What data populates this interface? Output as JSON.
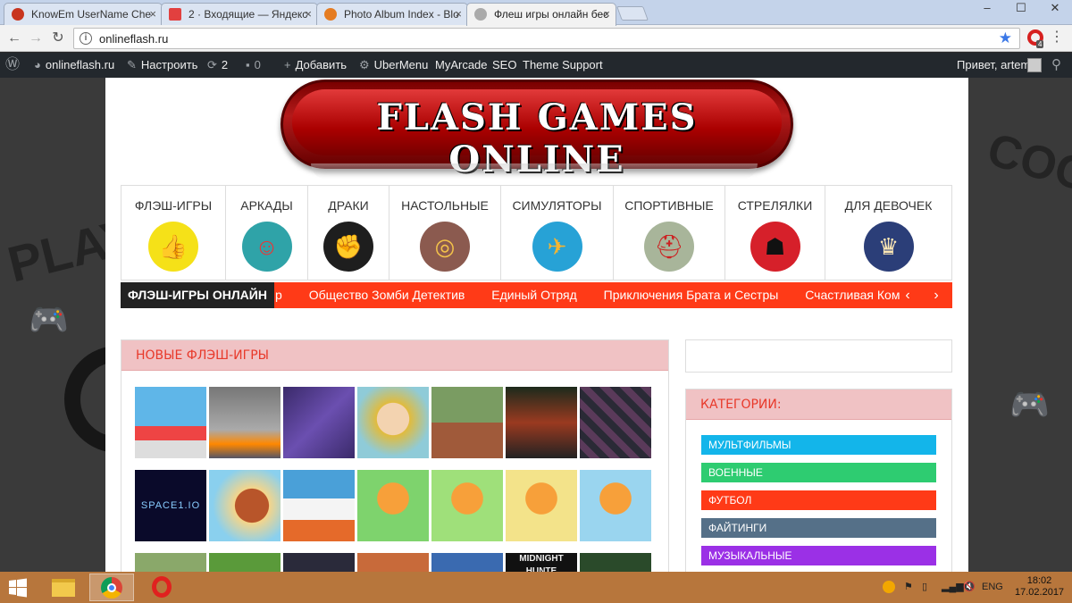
{
  "browser": {
    "tabs": [
      {
        "title": "KnowEm UserName Che",
        "favicon_color": "#c8351f"
      },
      {
        "title": "2 · Входящие — Яндекс",
        "favicon_color": "#e2403f"
      },
      {
        "title": "Photo Album Index - Blo",
        "favicon_color": "#e57c22"
      },
      {
        "title": "Флеш игры онлайн бес",
        "favicon_color": "#888888"
      }
    ],
    "url": "onlineflash.ru",
    "extension_badge": "4"
  },
  "adminbar": {
    "site": "onlineflash.ru",
    "customize": "Настроить",
    "updates": "2",
    "comments": "0",
    "add": "Добавить",
    "ubermenu": "UberMenu",
    "myarcade": "MyArcade",
    "seo": "SEO",
    "theme_support": "Theme Support",
    "greeting": "Привет, artem"
  },
  "site": {
    "logo_text": "FLASH GAMES ONLINE",
    "categories": [
      {
        "label": "ФЛЭШ-ИГРЫ",
        "icon": "thumbs-up-icon",
        "color": "#f5e118",
        "glyph": "👍"
      },
      {
        "label": "АРКАДЫ",
        "icon": "mario-icon",
        "color": "#2fa3a8",
        "glyph": "☺"
      },
      {
        "label": "ДРАКИ",
        "icon": "fist-icon",
        "color": "#1e1e1e",
        "glyph": "✊"
      },
      {
        "label": "НАСТОЛЬНЫЕ",
        "icon": "spiral-board-icon",
        "color": "#8b5a4f",
        "glyph": "◎"
      },
      {
        "label": "СИМУЛЯТОРЫ",
        "icon": "airplane-icon",
        "color": "#27a2d6",
        "glyph": "✈"
      },
      {
        "label": "СПОРТИВНЫЕ",
        "icon": "football-helmet-icon",
        "color": "#a8b59a",
        "glyph": "⛑"
      },
      {
        "label": "СТРЕЛЯЛКИ",
        "icon": "darth-vader-icon",
        "color": "#d6202a",
        "glyph": "☗"
      },
      {
        "label": "ДЛЯ ДЕВОЧЕК",
        "icon": "princess-icon",
        "color": "#2b3e78",
        "glyph": "♛"
      }
    ],
    "ticker": {
      "label": "ФЛЭШ-ИГРЫ ОНЛАЙН",
      "items": [
        "р",
        "Общество Зомби Детектив",
        "Единый Отряд",
        "Приключения Брата и Сестры",
        "Счастливая Комната"
      ]
    },
    "new_games_title": "НОВЫЕ ФЛЭШ-ИГРЫ",
    "categories_title": "КАТЕГОРИИ:",
    "sidebar_categories": [
      {
        "label": "МУЛЬТФИЛЬМЫ",
        "color": "#13b5ea"
      },
      {
        "label": "ВОЕННЫЕ",
        "color": "#2ecc71"
      },
      {
        "label": "ФУТБОЛ",
        "color": "#ff3a17"
      },
      {
        "label": "ФАЙТИНГИ",
        "color": "#557088"
      },
      {
        "label": "МУЗЫКАЛЬНЫЕ",
        "color": "#9b30e6"
      }
    ],
    "thumb_texts": {
      "space": "SPACE1.IO",
      "midnight": "MIDNIGHT HUNTE"
    }
  },
  "taskbar": {
    "lang": "ENG",
    "time": "18:02",
    "date": "17.02.2017"
  }
}
